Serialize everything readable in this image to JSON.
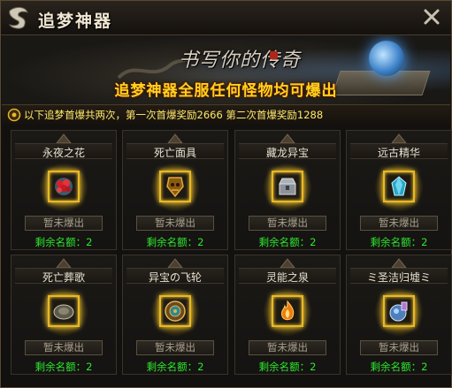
{
  "window": {
    "title": "追梦神器",
    "logo_icon": "dragon-emblem-icon",
    "close_icon": "close-x-icon"
  },
  "banner": {
    "calligraphy": "书写你的传奇",
    "tagline": "追梦神器全服任何怪物均可爆出"
  },
  "info": {
    "text": "以下追梦首爆共两次，第一次首爆奖励2666 第二次首爆奖励1288",
    "icon": "gold-coin-icon"
  },
  "colors": {
    "gold_accent": "#ffd21f",
    "info_text": "#ffe96a",
    "remaining_green": "#2ee62e"
  },
  "items": [
    {
      "name": "永夜之花",
      "status": "暂未爆出",
      "remaining_label": "剩余名额：",
      "remaining_count": "2",
      "icon": "red-flower-icon"
    },
    {
      "name": "死亡面具",
      "status": "暂未爆出",
      "remaining_label": "剩余名额：",
      "remaining_count": "2",
      "icon": "golden-mask-icon"
    },
    {
      "name": "藏龙异宝",
      "status": "暂未爆出",
      "remaining_label": "剩余名额：",
      "remaining_count": "2",
      "icon": "silver-chest-icon"
    },
    {
      "name": "远古精华",
      "status": "暂未爆出",
      "remaining_label": "剩余名额：",
      "remaining_count": "2",
      "icon": "blue-crystal-icon"
    },
    {
      "name": "死亡葬歌",
      "status": "暂未爆出",
      "remaining_label": "剩余名额：",
      "remaining_count": "2",
      "icon": "stone-disc-icon"
    },
    {
      "name": "异宝の飞轮",
      "status": "暂未爆出",
      "remaining_label": "剩余名额：",
      "remaining_count": "2",
      "icon": "bronze-wheel-icon"
    },
    {
      "name": "灵能之泉",
      "status": "暂未爆出",
      "remaining_label": "剩余名额：",
      "remaining_count": "2",
      "icon": "flame-spring-icon"
    },
    {
      "name": "ミ圣洁归墟ミ",
      "status": "暂未爆出",
      "remaining_label": "剩余名额：",
      "remaining_count": "2",
      "icon": "potion-orb-icon"
    }
  ]
}
